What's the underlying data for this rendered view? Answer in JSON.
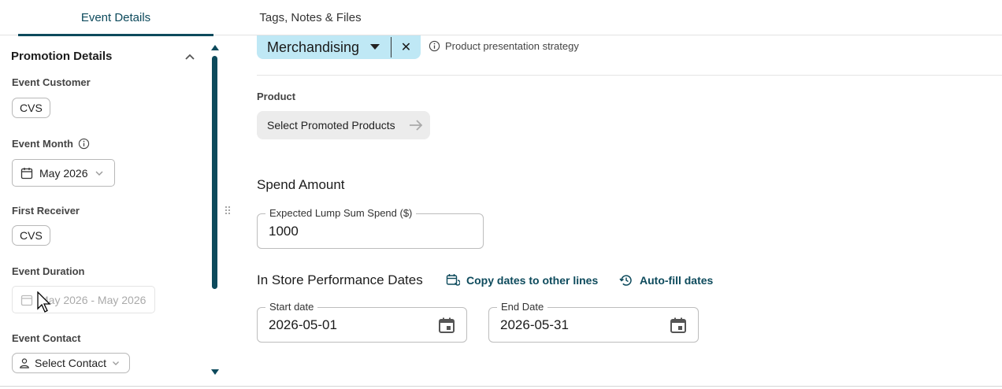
{
  "tabs": [
    {
      "label": "Event Details",
      "active": true
    },
    {
      "label": "Tags, Notes & Files",
      "active": false
    }
  ],
  "sidebar": {
    "section_title": "Promotion Details",
    "event_customer": {
      "label": "Event Customer",
      "value": "CVS"
    },
    "event_month": {
      "label": "Event Month",
      "value": "May 2026"
    },
    "first_receiver": {
      "label": "First Receiver",
      "value": "CVS"
    },
    "event_duration": {
      "label": "Event Duration",
      "value": "May 2026 - May 2026"
    },
    "event_contact": {
      "label": "Event Contact",
      "value": "Select Contact"
    }
  },
  "main": {
    "tactic_chip": "Merchandising",
    "tactic_hint": "Product presentation strategy",
    "product_label": "Product",
    "product_button": "Select Promoted Products",
    "spend_heading": "Spend Amount",
    "spend_field": {
      "label": "Expected Lump Sum Spend ($)",
      "value": "1000"
    },
    "dates_heading": "In Store Performance Dates",
    "copy_dates_link": "Copy dates to other lines",
    "autofill_link": "Auto-fill dates",
    "start_date": {
      "label": "Start date",
      "value": "2026-05-01"
    },
    "end_date": {
      "label": "End Date",
      "value": "2026-05-31"
    }
  },
  "colors": {
    "accent": "#0d4a5c",
    "chip_bg": "#bfe8f5"
  }
}
